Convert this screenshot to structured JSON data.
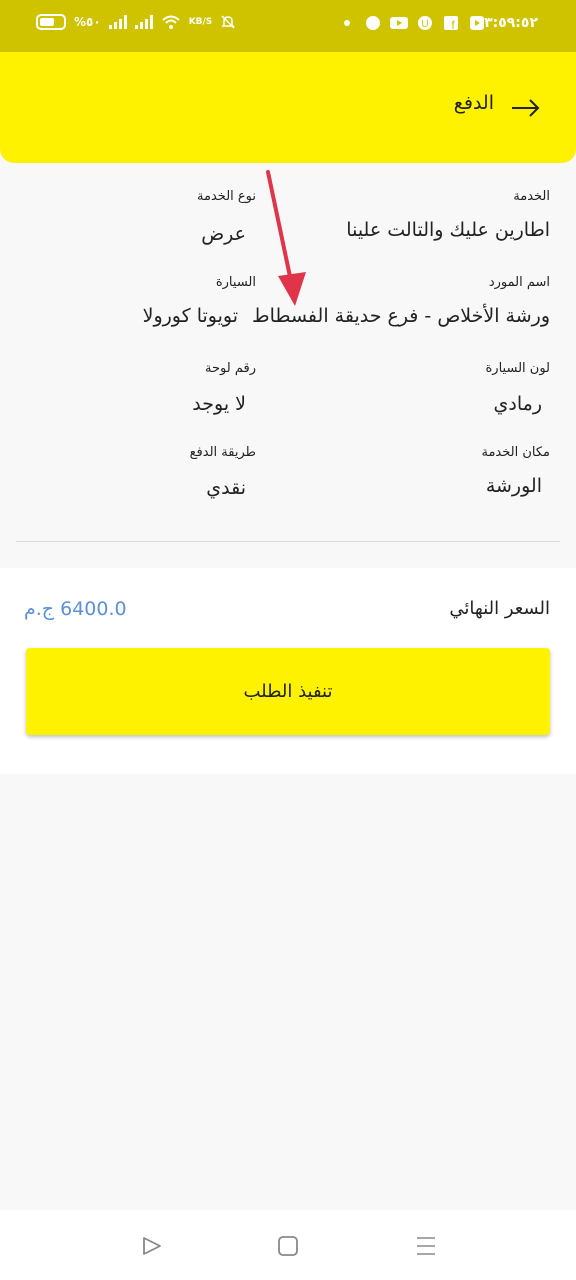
{
  "status_bar": {
    "time": "٣:٥٩:٥٢",
    "battery": "%٥٠",
    "speed_unit": "KB/S",
    "icons": [
      "battery-icon",
      "signal-icon",
      "signal-icon",
      "wifi-icon",
      "bell-off-icon",
      "dot-icon",
      "whatsapp-icon",
      "youtube-icon",
      "u-app-icon",
      "facebook-icon",
      "video-icon"
    ]
  },
  "app_bar": {
    "title": "الدفع"
  },
  "details": {
    "service_label": "الخدمة",
    "service_value": "اطارين عليك والتالت علينا",
    "service_type_label": "نوع الخدمة",
    "service_type_value": "عرض",
    "supplier_label": "اسم المورد",
    "supplier_value": "ورشة الأخلاص  - فرع حديقة الفسطاط",
    "car_label": "السيارة",
    "car_value": "تويوتا كورولا",
    "car_color_label": "لون السيارة",
    "car_color_value": "رمادي",
    "plate_label": "رقم لوحة",
    "plate_value": "لا يوجد",
    "service_place_label": "مكان الخدمة",
    "service_place_value": "الورشة",
    "payment_method_label": "طريقة الدفع",
    "payment_method_value": "نقدي"
  },
  "price": {
    "label": "السعر النهائي",
    "value": "6400.0 ج.م"
  },
  "submit_label": "تنفيذ الطلب",
  "colors": {
    "accent": "#fff200",
    "status_bar": "#cfc300",
    "price": "#5b8fd6",
    "annotation_arrow": "#e0344a"
  },
  "nav_bar": {
    "icons": [
      "back-triangle-icon",
      "home-square-icon",
      "menu-lines-icon"
    ]
  }
}
